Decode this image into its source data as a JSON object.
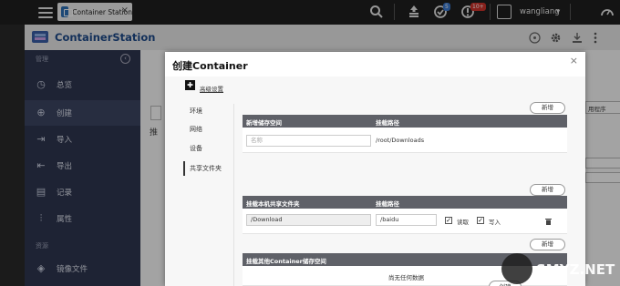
{
  "topbar": {
    "tab_label": "Container Station",
    "tab_close": "×",
    "badge_updates": "5",
    "badge_alerts": "10+",
    "username": "wangliang",
    "username_caret": "▾"
  },
  "app": {
    "brand": "ContainerStation"
  },
  "sidebar": {
    "section_manage": "管理",
    "section_resources": "资源",
    "items": [
      {
        "label": "总览",
        "icon": "dashboard-icon"
      },
      {
        "label": "创建",
        "icon": "plus-circle-icon"
      },
      {
        "label": "导入",
        "icon": "import-icon"
      },
      {
        "label": "导出",
        "icon": "export-icon"
      },
      {
        "label": "记录",
        "icon": "log-icon"
      },
      {
        "label": "属性",
        "icon": "sliders-icon"
      },
      {
        "label": "镜像文件",
        "icon": "layers-icon"
      }
    ]
  },
  "background": {
    "frag_left": "推",
    "frag_right": "用程序"
  },
  "dialog": {
    "title": "创建Container",
    "close": "×",
    "advanced_settings": "高级设置",
    "tabs": [
      "环境",
      "网络",
      "设备",
      "共享文件夹"
    ],
    "active_tab": "共享文件夹",
    "new_label": "新增",
    "volume_table": {
      "col1": "新增储存空间",
      "col2": "挂载路径",
      "name_placeholder": "名称",
      "mount_path": "/root/Downloads"
    },
    "shared_table": {
      "col1": "挂载本机共享文件夹",
      "col2": "挂载路径",
      "host_folder": "/Download",
      "mount_path": "/baidu",
      "read_label": "读取",
      "write_label": "写入",
      "read_checked": true,
      "write_checked": true
    },
    "other_table": {
      "col1": "挂载其他Container储存空间",
      "empty": "尚无任何数据"
    },
    "create_button": "创建"
  },
  "watermark": {
    "text": "SMYZ.NET"
  }
}
